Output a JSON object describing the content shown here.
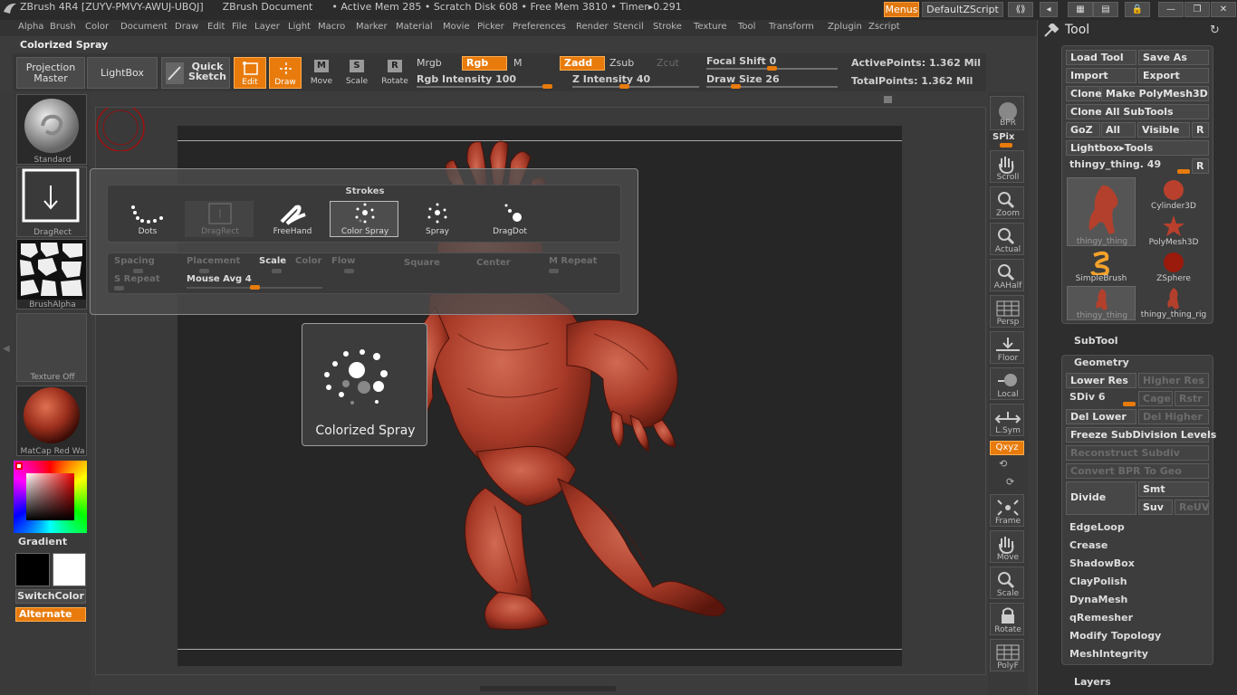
{
  "title_bar": {
    "app": "ZBrush 4R4",
    "serial": "[ZUYV-PMVY-AWUJ-UBQJ]",
    "doc": "ZBrush Document",
    "stats": "• Active Mem 285 • Scratch Disk 608 • Free Mem 3810 • Timer▸0.291",
    "menus_btn": "Menus",
    "script_btn": "DefaultZScript"
  },
  "menu_items": [
    "Alpha",
    "Brush",
    "Color",
    "Document",
    "Draw",
    "Edit",
    "File",
    "Layer",
    "Light",
    "Macro",
    "Marker",
    "Material",
    "Movie",
    "Picker",
    "Preferences",
    "Render",
    "Stencil",
    "Stroke",
    "Texture",
    "Tool",
    "Transform",
    "Zplugin",
    "Zscript"
  ],
  "doc_title": "Colorized Spray",
  "toolbar": {
    "projection_master": "Projection Master",
    "lightbox": "LightBox",
    "quick_sketch": "Quick Sketch",
    "edit": "Edit",
    "draw": "Draw",
    "move": "Move",
    "scale": "Scale",
    "rotate": "Rotate",
    "mrgb": "Mrgb",
    "rgb": "Rgb",
    "m": "M",
    "zadd": "Zadd",
    "zsub": "Zsub",
    "zcut": "Zcut",
    "rgb_intensity": "Rgb Intensity 100",
    "z_intensity": "Z Intensity 40",
    "focal_shift": "Focal Shift 0",
    "draw_size": "Draw Size 26",
    "active_points": "ActivePoints: 1.362 Mil",
    "total_points": "TotalPoints: 1.362 Mil"
  },
  "sliders": {
    "rgb_intensity": 1.0,
    "z_intensity": 0.4,
    "focal_shift": 0.5,
    "draw_size": 0.2
  },
  "left_shelf": {
    "brush": "Standard",
    "stroke": "DragRect",
    "alpha": "BrushAlpha",
    "texture": "Texture Off",
    "material": "MatCap Red Wa",
    "gradient": "Gradient",
    "switch_color": "SwitchColor",
    "alternate": "Alternate"
  },
  "right_shelf": {
    "bpr": "BPR",
    "spix": "SPix",
    "scroll": "Scroll",
    "zoom": "Zoom",
    "actual": "Actual",
    "aahalf": "AAHalf",
    "persp": "Persp",
    "floor": "Floor",
    "local": "Local",
    "lsym": "L.Sym",
    "xyz": "Qxyz",
    "frame": "Frame",
    "move": "Move",
    "scale": "Scale",
    "rotate": "Rotate",
    "polyf": "PolyF"
  },
  "strokes_popup": {
    "title": "Strokes",
    "items": [
      {
        "label": "Dots"
      },
      {
        "label": "DragRect"
      },
      {
        "label": "FreeHand"
      },
      {
        "label": "Color Spray"
      },
      {
        "label": "Spray"
      },
      {
        "label": "DragDot"
      }
    ],
    "options": {
      "spacing": "Spacing",
      "placement": "Placement",
      "scale": "Scale",
      "color": "Color",
      "flow": "Flow",
      "square": "Square",
      "center": "Center",
      "m_repeat": "M Repeat",
      "s_repeat": "S Repeat",
      "mouse_avg": "Mouse Avg 4"
    },
    "mouse_avg_level": 0.5
  },
  "tooltip": {
    "label": "Colorized Spray"
  },
  "tool_panel": {
    "title": "Tool",
    "load_tool": "Load Tool",
    "save_as": "Save As",
    "import": "Import",
    "export": "Export",
    "clone": "Clone",
    "make_polymesh": "Make PolyMesh3D",
    "clone_all": "Clone All SubTools",
    "goz": "GoZ",
    "all": "All",
    "visible": "Visible",
    "r": "R",
    "lightbox_tools": "Lightbox▸Tools",
    "current_tool": "thingy_thing. 49",
    "thumbs": [
      "thingy_thing",
      "Cylinder3D",
      "PolyMesh3D",
      "SimpleBrush",
      "ZSphere",
      "thingy_thing",
      "thingy_thing_rig"
    ],
    "subtool": "SubTool",
    "geometry": "Geometry",
    "lower_res": "Lower Res",
    "higher_res": "Higher Res",
    "sdiv": "SDiv 6",
    "cage": "Cage",
    "rstr": "Rstr",
    "del_lower": "Del Lower",
    "del_higher": "Del Higher",
    "freeze": "Freeze SubDivision Levels",
    "reconstruct": "Reconstruct Subdiv",
    "convert_bpr": "Convert BPR To Geo",
    "divide": "Divide",
    "smt": "Smt",
    "suv": "Suv",
    "reuv": "ReUV",
    "sections": [
      "EdgeLoop",
      "Crease",
      "ShadowBox",
      "ClayPolish",
      "DynaMesh",
      "qRemesher",
      "Modify Topology",
      "MeshIntegrity"
    ],
    "layers": "Layers"
  },
  "colors": {
    "accent": "#e87b0c",
    "model": "#b3402c",
    "secondary_color": "#ffffff",
    "main_color": "#000000"
  }
}
